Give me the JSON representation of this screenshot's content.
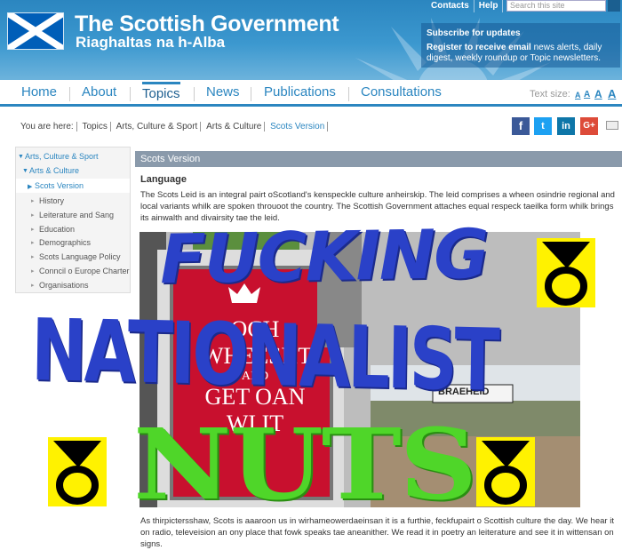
{
  "header": {
    "title": "The Scottish Government",
    "subtitle": "Riaghaltas na h-Alba",
    "top_links": [
      "Contacts",
      "Help"
    ],
    "search_placeholder": "Search this site",
    "subscribe_title": "Subscribe for updates",
    "subscribe_bold": "Register to receive email",
    "subscribe_text": " news alerts, daily digest, weekly roundup or Topic newsletters."
  },
  "nav": {
    "items": [
      "Home",
      "About",
      "Topics",
      "News",
      "Publications",
      "Consultations"
    ],
    "active": "Topics",
    "text_size_label": "Text size:",
    "text_sizes": [
      "A",
      "A",
      "A",
      "A"
    ]
  },
  "breadcrumb": {
    "label": "You are here:",
    "items": [
      "Topics",
      "Arts, Culture & Sport",
      "Arts & Culture",
      "Scots Version"
    ]
  },
  "share": [
    "f",
    "t",
    "in",
    "G+"
  ],
  "sidebar": {
    "items": [
      "Arts, Culture & Sport",
      "Arts & Culture",
      "Scots Version",
      "History",
      "Leiterature and Sang",
      "Education",
      "Demographics",
      "Scots Language Policy",
      "Conncil o Europe Charter",
      "Organisations"
    ]
  },
  "main": {
    "section_title": "Scots Version",
    "heading": "Language",
    "intro": "The Scots Leid is an integral pairt oScotland's kenspeckle culture anheirskip.  The leid comprises a wheen osindrie regional and local variants whilk are spoken throuoot the country.  The Scottish Government attaches equal respeck taeilka form whilk brings its ainwalth and divairsity tae the leid.",
    "outro": "As thirpictersshaw, Scots is aaaroon us in wirhameowerdaeinsan it is a furthie, feckfupairt o Scottish culture the day. We hear it  on radio, televeision an ony place that fowk speaks tae aneanither. We read it in poetry an leiterature and see it in wittensan on signs."
  },
  "photo": {
    "sign_lines": [
      "OCH",
      "WHEESHT",
      "AND",
      "GET OAN",
      "WI IT"
    ],
    "street_sign": "BRAEHEID"
  },
  "overlay": {
    "line1": "FUCKING",
    "line2": "NATIONALIST",
    "line3": "NUTS"
  },
  "colors": {
    "brand_blue": "#2b86c0",
    "graffiti_blue": "#2a41c8",
    "graffiti_green": "#4fd629",
    "snp_yellow": "#fff200"
  }
}
